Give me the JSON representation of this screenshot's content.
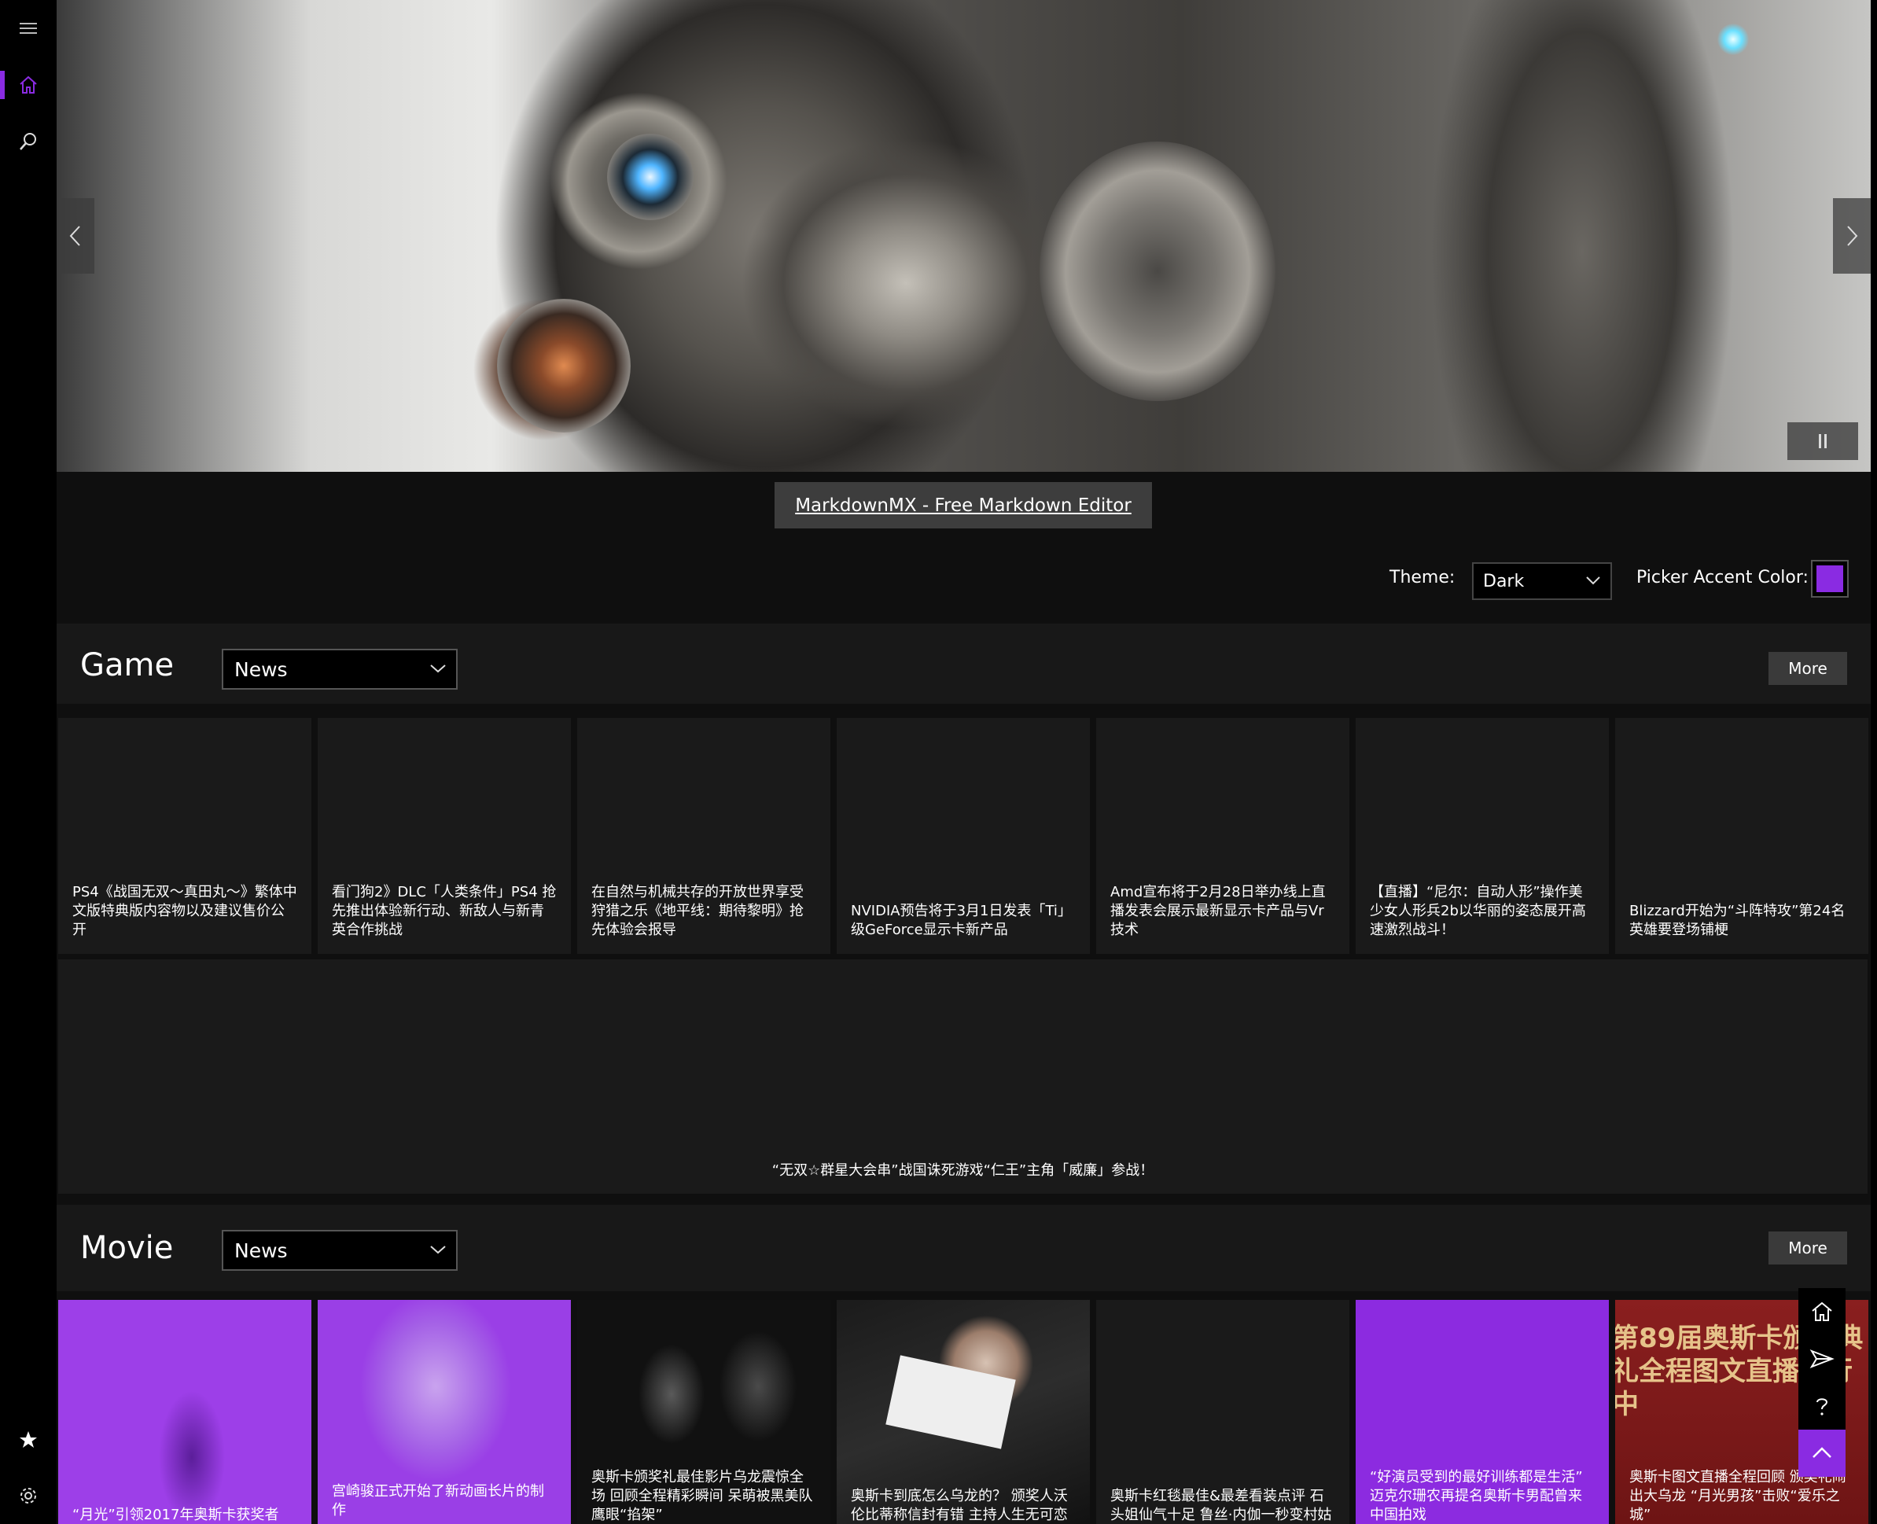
{
  "accent_color": "#8a2be2",
  "rail": {
    "icons": [
      "hamburger-menu-icon",
      "home-icon",
      "search-icon",
      "star-icon",
      "gear-icon"
    ]
  },
  "hero": {
    "promo_link": "MarkdownMX - Free Markdown Editor"
  },
  "settings": {
    "theme_label": "Theme:",
    "theme_value": "Dark",
    "accent_label": "Picker Accent Color:"
  },
  "game": {
    "title": "Game",
    "category": "News",
    "more": "More",
    "items": [
      "PS4《战国无双～真田丸～》繁体中文版特典版内容物以及建议售价公开",
      "看门狗2》DLC「人类条件」PS4 抢先推出体验新行动、新敌人与新青英合作挑战",
      "在自然与机械共存的开放世界享受狩猎之乐《地平线：期待黎明》抢先体验会报导",
      "NVIDIA预告将于3月1日发表「Ti」级GeForce显示卡新产品",
      "Amd宣布将于2月28日举办线上直播发表会展示最新显示卡产品与Vr技术",
      "【直播】“尼尔：自动人形”操作美少女人形兵2b以华丽的姿态展开高速激烈战斗！",
      "Blizzard开始为“斗阵特攻”第24名英雄要登场铺梗"
    ],
    "featured": "“无双☆群星大会串”战国诛死游戏“仁王”主角「威廉」参战！"
  },
  "movie": {
    "title": "Movie",
    "category": "News",
    "more": "More",
    "items": [
      "“月光”引领2017年奥斯卡获奖者",
      "宫崎骏正式开始了新动画长片的制作",
      "奥斯卡颁奖礼最佳影片乌龙震惊全场 回顾全程精彩瞬间 呆萌被黑美队鹰眼“掐架”",
      "奥斯卡到底怎么乌龙的？ 颁奖人沃伦比蒂称信封有错 主持人生无可恋",
      "奥斯卡红毯最佳&最差看装点评 石头姐仙气十足 鲁丝·内伽一秒变村姑",
      "“好演员受到的最好训练都是生活” 迈克尔珊农再提名奥斯卡男配曾来中国拍戏",
      "奥斯卡图文直播全程回顾 颁奖礼闹出大乌龙 “月光男孩”击败“爱乐之城”"
    ],
    "poster_text": "第89届奥斯卡颁奖典礼全程图文直播进行中"
  },
  "tools": {
    "icons": [
      "home-icon",
      "send-icon",
      "help-icon",
      "scroll-top-icon"
    ]
  }
}
